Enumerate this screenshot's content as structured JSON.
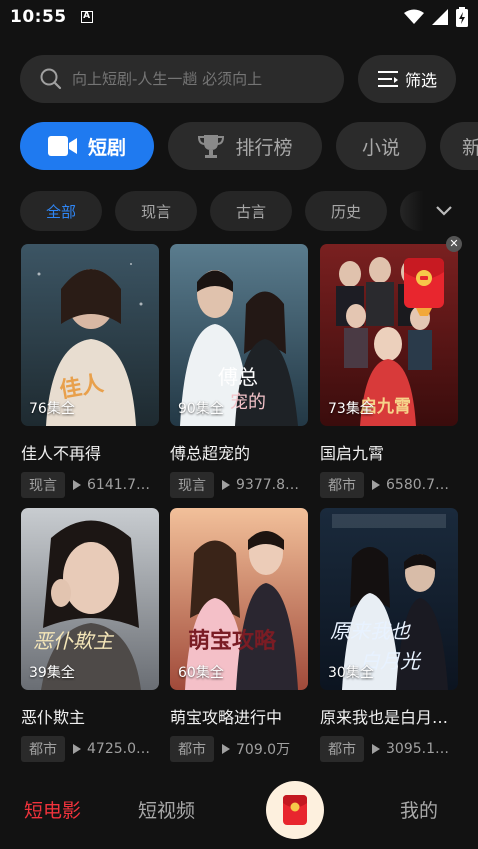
{
  "status_bar": {
    "time": "10:55"
  },
  "search": {
    "placeholder": "向上短剧-人生一趟 必须向上",
    "filter_label": "筛选"
  },
  "main_tabs": [
    {
      "label": "短剧",
      "active": true
    },
    {
      "label": "排行榜",
      "active": false
    },
    {
      "label": "小说",
      "active": false
    },
    {
      "label": "新",
      "active": false
    }
  ],
  "categories": [
    {
      "label": "全部",
      "active": true
    },
    {
      "label": "现言",
      "active": false
    },
    {
      "label": "古言",
      "active": false
    },
    {
      "label": "历史",
      "active": false
    }
  ],
  "dramas": [
    {
      "title": "佳人不再得",
      "episodes": "76集全",
      "tag": "现言",
      "views": "6141.7…",
      "poster_text": "佳人不再得"
    },
    {
      "title": "傅总超宠的",
      "episodes": "90集全",
      "tag": "现言",
      "views": "9377.8…",
      "poster_text": "傅总超宠的"
    },
    {
      "title": "国启九霄",
      "episodes": "73集全",
      "tag": "都市",
      "views": "6580.7…",
      "poster_text": "国启九霄"
    },
    {
      "title": "恶仆欺主",
      "episodes": "39集全",
      "tag": "都市",
      "views": "4725.0…",
      "poster_text": "恶仆欺主"
    },
    {
      "title": "萌宝攻略进行中",
      "episodes": "60集全",
      "tag": "都市",
      "views": "709.0万",
      "poster_text": "萌宝攻略"
    },
    {
      "title": "原来我也是白月…",
      "episodes": "30集全",
      "tag": "都市",
      "views": "3095.1…",
      "poster_text": "原来我也是白月光"
    }
  ],
  "bottom_nav": {
    "short_movie": "短电影",
    "short_video": "短视频",
    "mine": "我的"
  },
  "colors": {
    "accent": "#1f7af0",
    "nav_active": "#f0333c"
  }
}
